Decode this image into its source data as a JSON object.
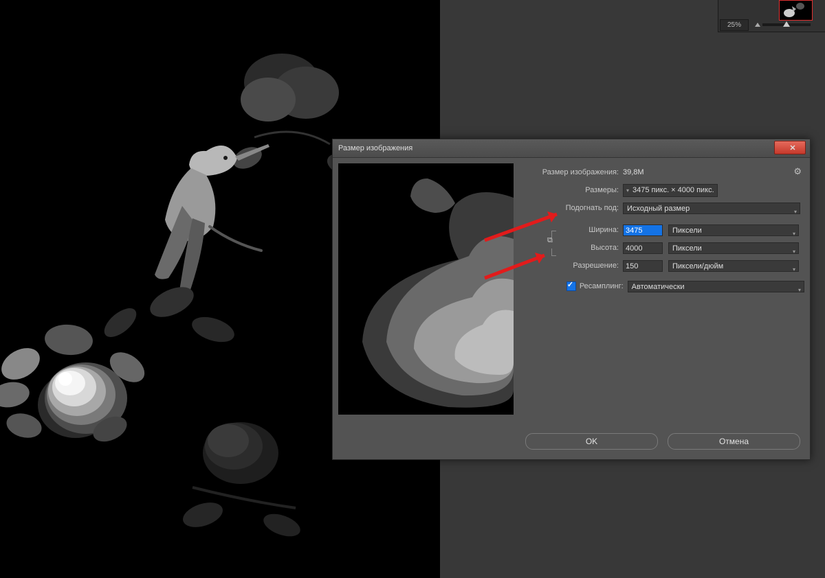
{
  "side": {
    "zoom": "25%"
  },
  "dialog": {
    "title": "Размер изображения",
    "size_label": "Размер изображения:",
    "size_value": "39,8M",
    "dims_label": "Размеры:",
    "dims_value_w": "3475 пикс.",
    "dims_sep": "×",
    "dims_value_h": "4000 пикс.",
    "fit_label": "Подогнать под:",
    "fit_value": "Исходный размер",
    "width_label": "Ширина:",
    "width_value": "3475",
    "width_unit": "Пиксели",
    "height_label": "Высота:",
    "height_value": "4000",
    "height_unit": "Пиксели",
    "res_label": "Разрешение:",
    "res_value": "150",
    "res_unit": "Пиксели/дюйм",
    "resample_label": "Ресамплинг:",
    "resample_value": "Автоматически",
    "ok": "OK",
    "cancel": "Отмена"
  }
}
